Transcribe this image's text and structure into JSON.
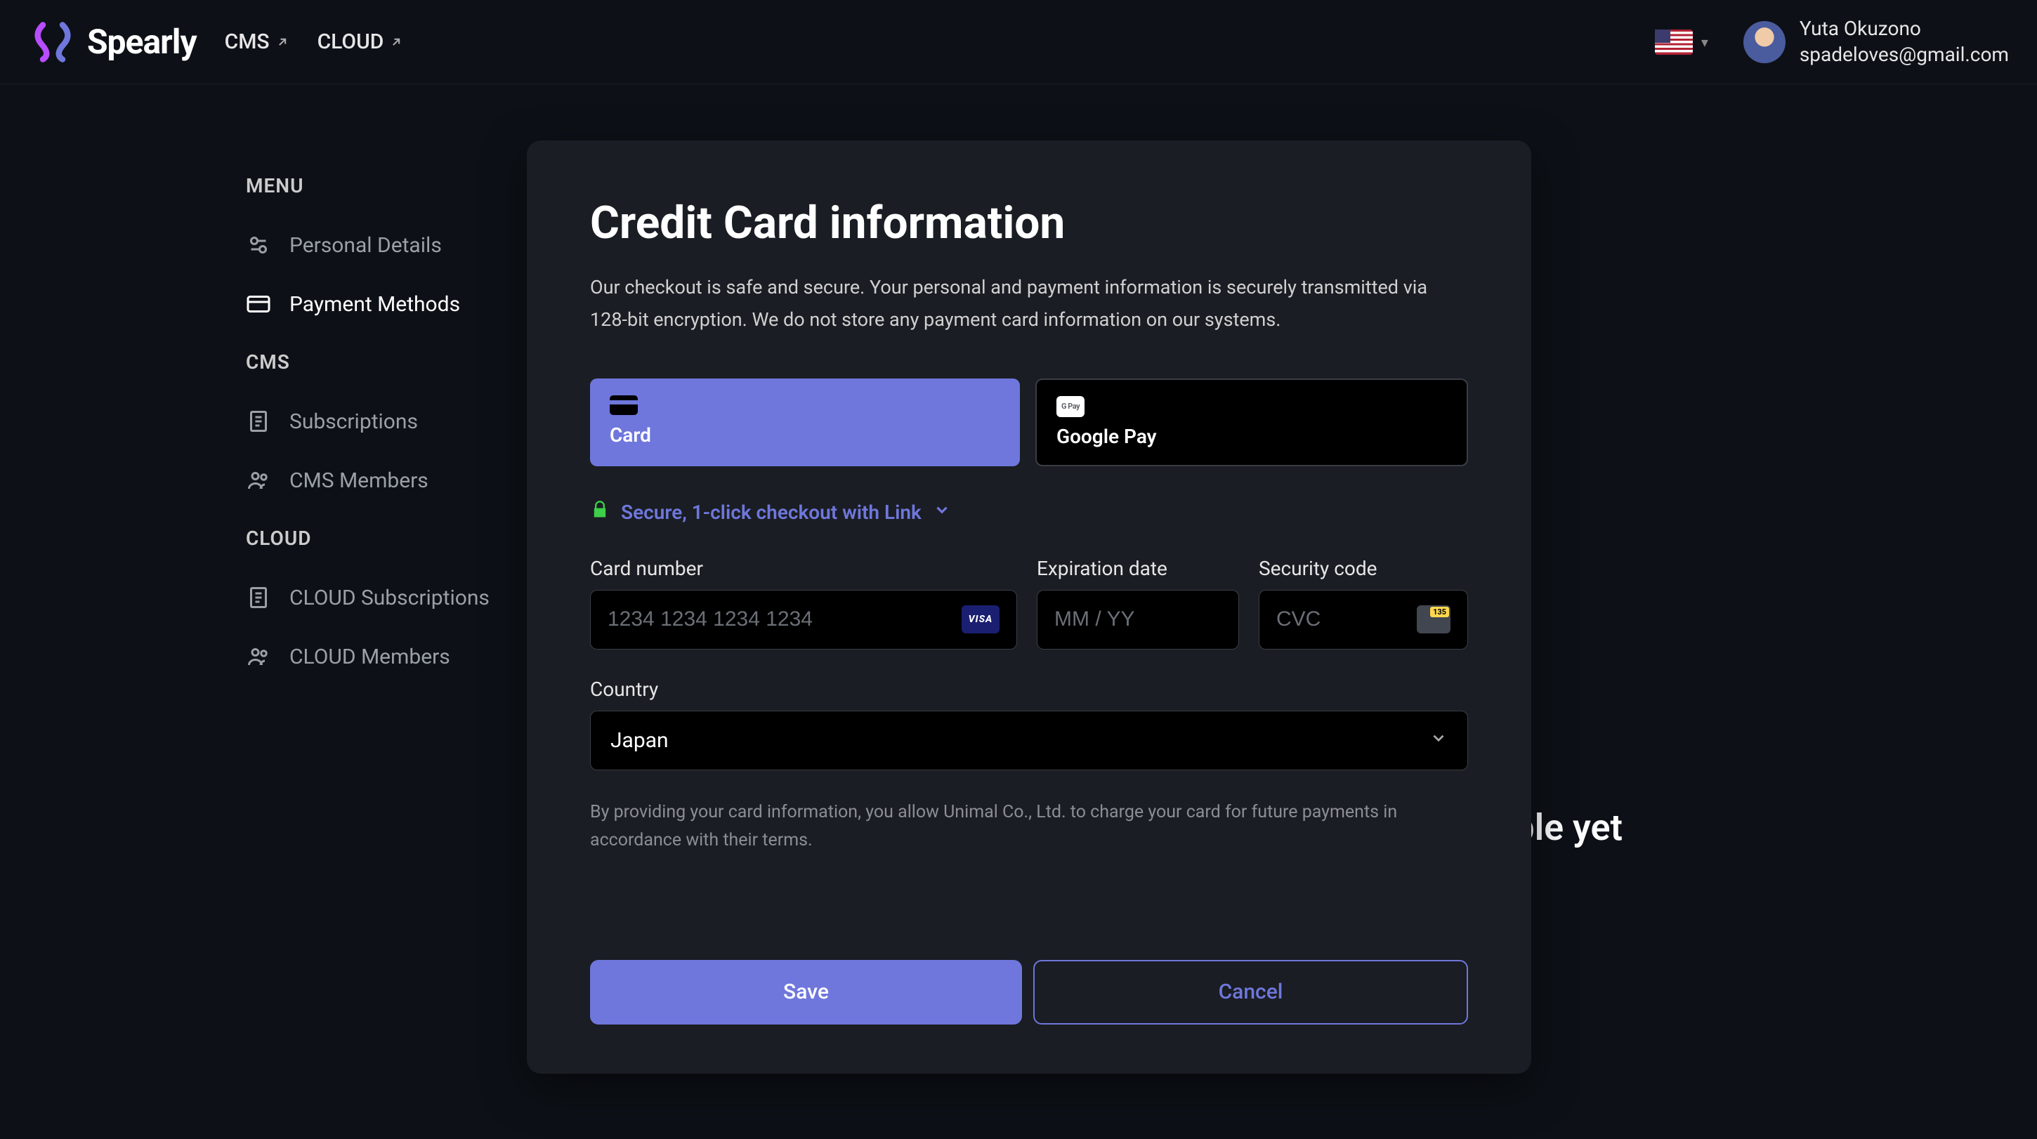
{
  "brand": {
    "name": "Spearly"
  },
  "nav": {
    "items": [
      {
        "label": "CMS"
      },
      {
        "label": "CLOUD"
      }
    ]
  },
  "user": {
    "name": "Yuta Okuzono",
    "email": "spadeloves@gmail.com"
  },
  "sidebar": {
    "sections": [
      {
        "title": "MENU",
        "items": [
          {
            "label": "Personal Details"
          },
          {
            "label": "Payment Methods"
          }
        ]
      },
      {
        "title": "CMS",
        "items": [
          {
            "label": "Subscriptions"
          },
          {
            "label": "CMS Members"
          }
        ]
      },
      {
        "title": "CLOUD",
        "items": [
          {
            "label": "CLOUD Subscriptions"
          },
          {
            "label": "CLOUD Members"
          }
        ]
      }
    ]
  },
  "bg_message": "ble yet",
  "modal": {
    "title": "Credit Card information",
    "description": "Our checkout is safe and secure. Your personal and payment information is securely transmitted via 128-bit encryption. We do not store any payment card information on our systems.",
    "pay_methods": {
      "card": "Card",
      "gpay": "Google Pay",
      "gpay_badge": "G Pay"
    },
    "link_row": "Secure, 1-click checkout with Link",
    "labels": {
      "card_number": "Card number",
      "expiration": "Expiration date",
      "cvc": "Security code",
      "country": "Country"
    },
    "placeholders": {
      "card_number": "1234 1234 1234 1234",
      "expiration": "MM / YY",
      "cvc": "CVC"
    },
    "visa_text": "VISA",
    "country_value": "Japan",
    "disclaimer": "By providing your card information, you allow Unimal Co., Ltd. to charge your card for future payments in accordance with their terms.",
    "buttons": {
      "save": "Save",
      "cancel": "Cancel"
    }
  }
}
